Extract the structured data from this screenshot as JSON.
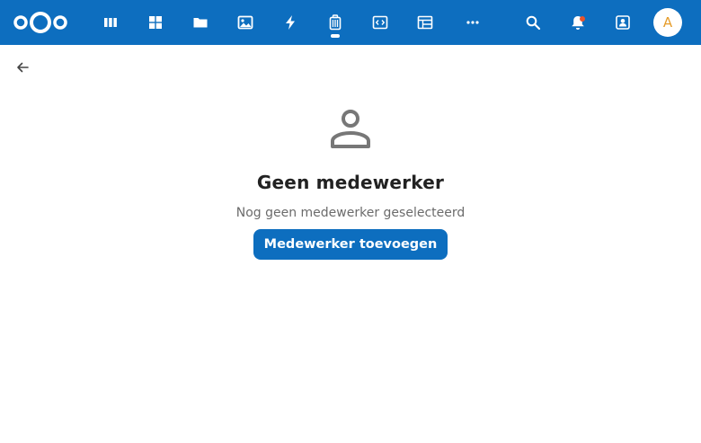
{
  "header": {
    "logo_icon": "nextcloud-logo",
    "apps": [
      {
        "id": "dashboard",
        "icon": "dashboard-icon"
      },
      {
        "id": "apps-grid",
        "icon": "apps-grid-icon"
      },
      {
        "id": "files",
        "icon": "folder-icon"
      },
      {
        "id": "photos",
        "icon": "image-icon"
      },
      {
        "id": "activity",
        "icon": "lightning-icon"
      },
      {
        "id": "timemanager",
        "icon": "trash-bin-icon",
        "active": true
      },
      {
        "id": "code",
        "icon": "code-window-icon"
      },
      {
        "id": "tables",
        "icon": "table-icon"
      },
      {
        "id": "more",
        "icon": "more-icon"
      }
    ],
    "right_icons": [
      "search-icon",
      "bell-icon",
      "contacts-icon"
    ],
    "avatar_initial": "A"
  },
  "content": {
    "back_icon": "arrow-left-icon",
    "empty_icon": "person-icon",
    "title": "Geen medewerker",
    "description": "Nog geen medewerker geselecteerd",
    "button_label": "Medewerker toevoegen"
  },
  "colors": {
    "header_bg": "#0d6ebf",
    "button_bg": "#0d6ebf",
    "notification_dot": "#e9542b",
    "avatar_text": "#e69c2a"
  }
}
